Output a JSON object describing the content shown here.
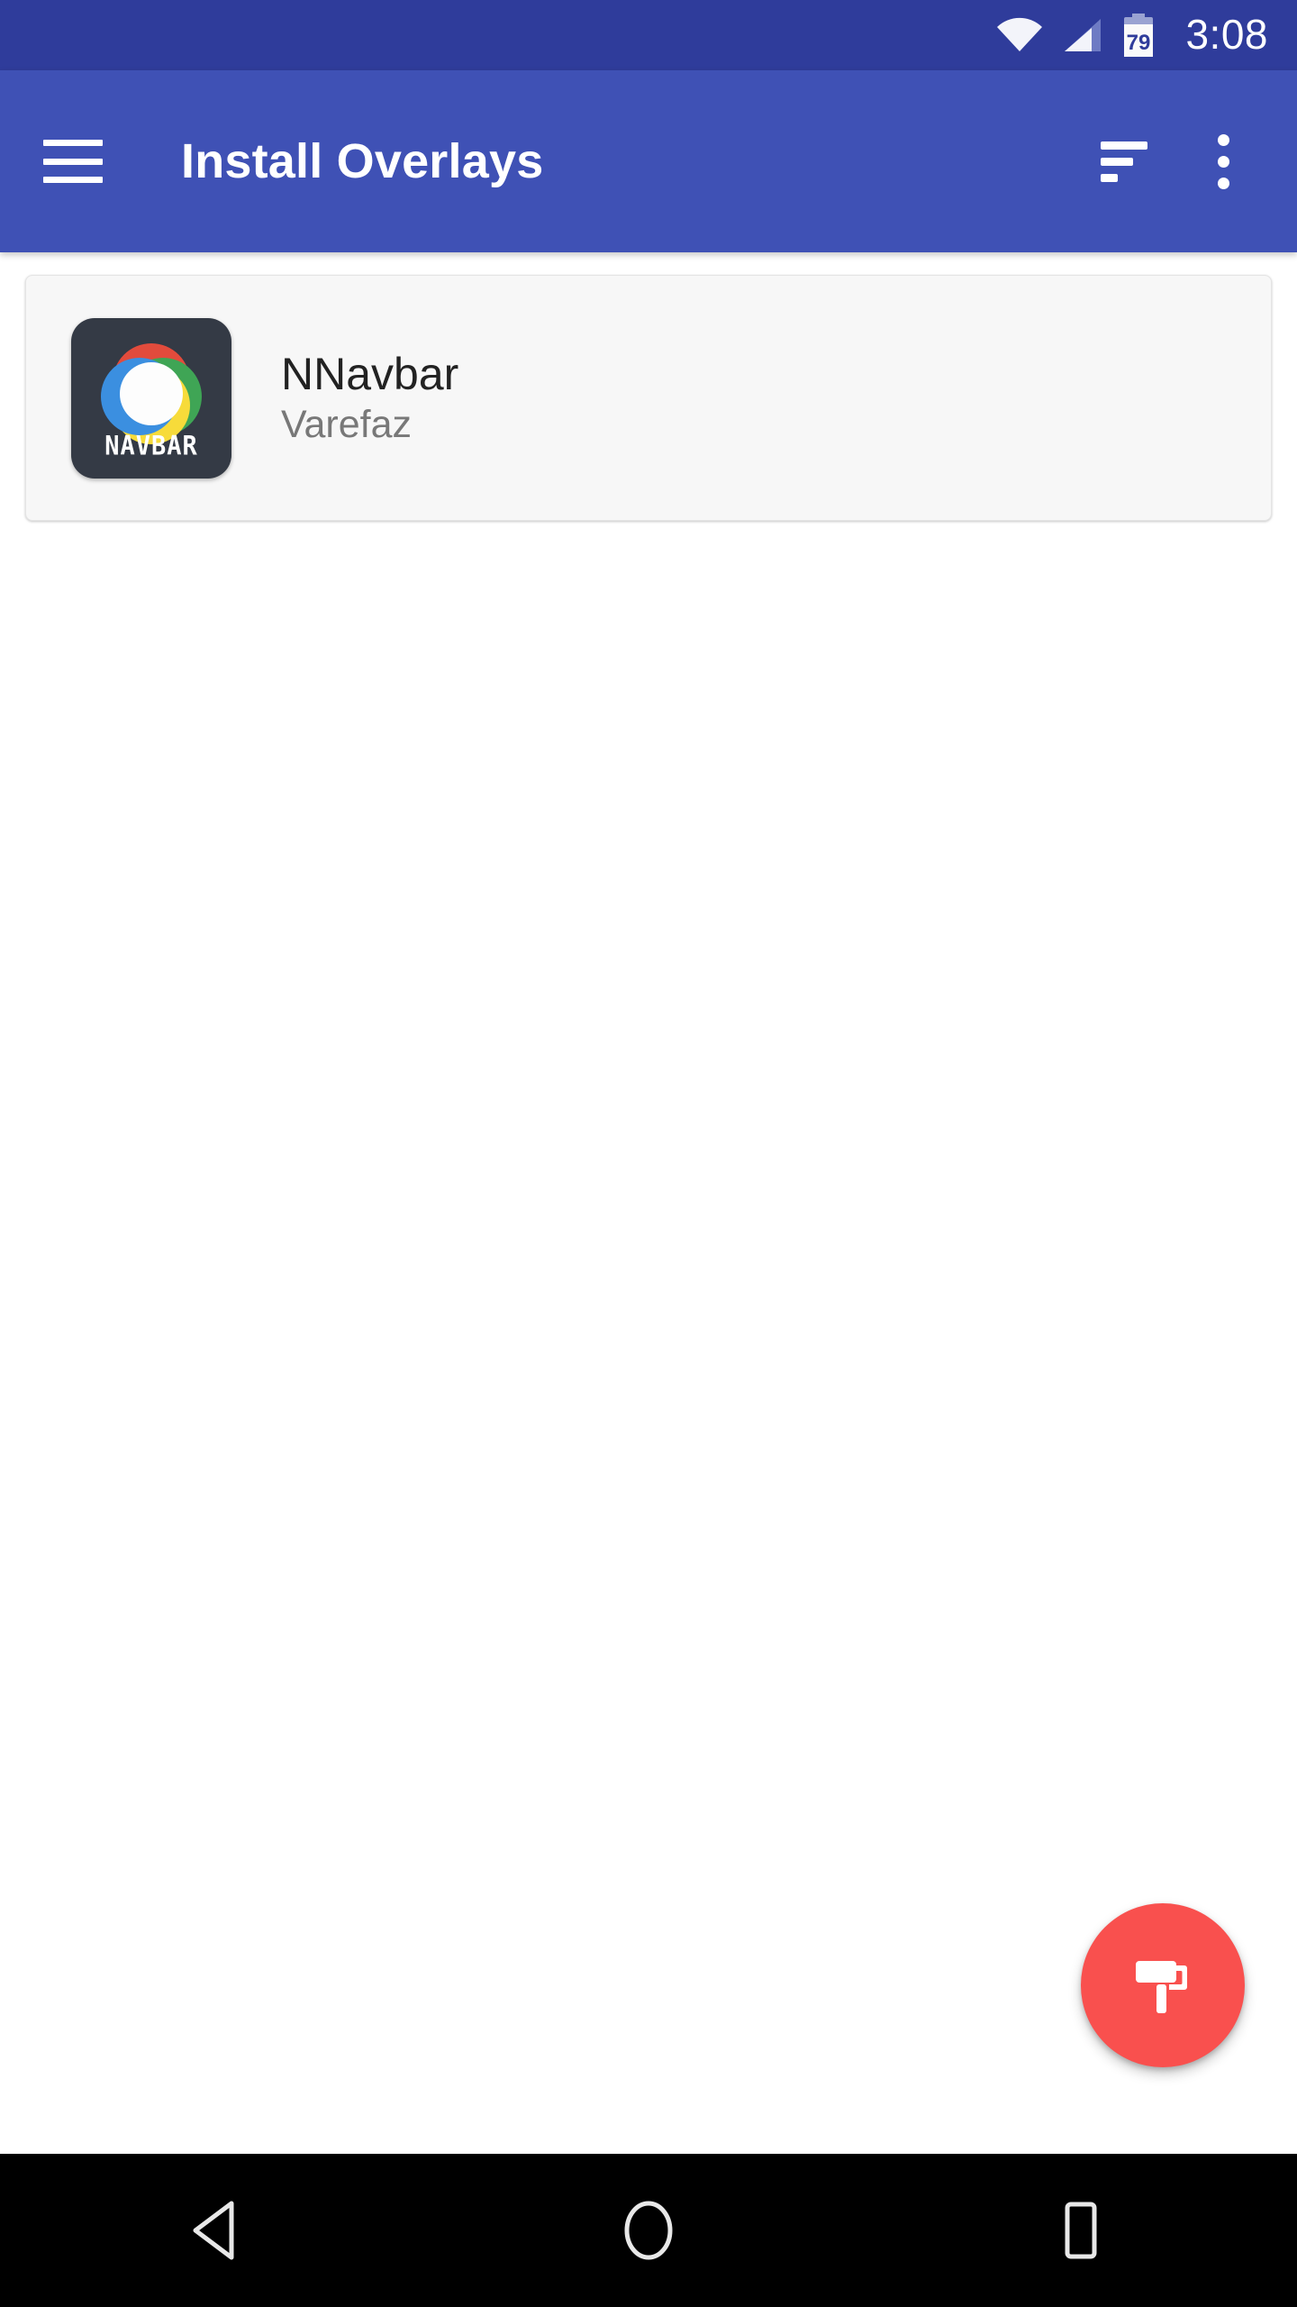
{
  "status_bar": {
    "time": "3:08",
    "battery_percent": "79",
    "wifi_icon": "wifi-icon",
    "signal_icon": "cellular-signal-icon",
    "battery_icon": "battery-icon",
    "background_color": "#2F3C9B"
  },
  "app_bar": {
    "title": "Install Overlays",
    "menu_icon": "hamburger-menu-icon",
    "sort_icon": "sort-filter-icon",
    "overflow_icon": "overflow-menu-icon",
    "background_color": "#3F51B5",
    "text_color": "#FFFFFF"
  },
  "overlay_list": {
    "items": [
      {
        "title": "NNavbar",
        "subtitle": "Varefaz",
        "icon_wordmark": "NAVBAR",
        "icon_name": "nnavbar-app-icon"
      }
    ]
  },
  "fab": {
    "icon": "paint-roller-icon",
    "color": "#F9504E"
  },
  "nav_bar": {
    "back": "back-button",
    "home": "home-button",
    "recents": "recents-button",
    "background_color": "#000000"
  }
}
